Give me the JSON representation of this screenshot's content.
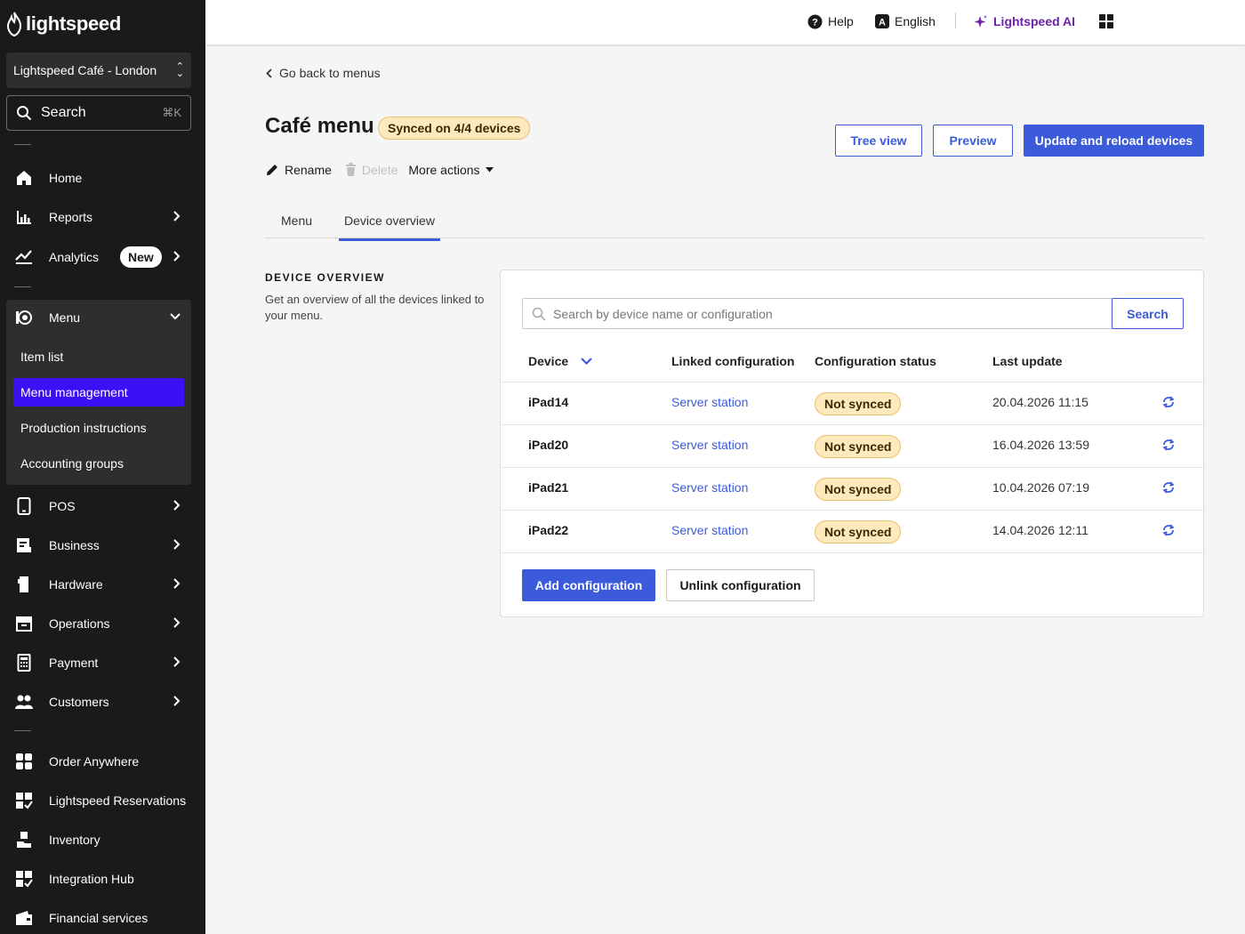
{
  "brand": {
    "logo_text": "lightspeed"
  },
  "sidebar": {
    "location": "Lightspeed Café - London",
    "search": {
      "label": "Search",
      "shortcut": "⌘K"
    },
    "nav": [
      {
        "label": "Home",
        "icon": "home-icon"
      },
      {
        "label": "Reports",
        "icon": "bar-chart-icon"
      },
      {
        "label": "Analytics",
        "icon": "trend-icon",
        "badge": "New"
      },
      {
        "label": "Menu",
        "icon": "menu-icon"
      },
      {
        "label": "POS",
        "icon": "tablet-icon"
      },
      {
        "label": "Business",
        "icon": "business-icon"
      },
      {
        "label": "Hardware",
        "icon": "hardware-icon"
      },
      {
        "label": "Operations",
        "icon": "box-icon"
      },
      {
        "label": "Payment",
        "icon": "calculator-icon"
      },
      {
        "label": "Customers",
        "icon": "users-icon"
      },
      {
        "label": "Order Anywhere",
        "icon": "grid-icon"
      },
      {
        "label": "Lightspeed Reservations",
        "icon": "reservations-icon"
      },
      {
        "label": "Inventory",
        "icon": "inventory-icon"
      },
      {
        "label": "Integration Hub",
        "icon": "integration-icon"
      },
      {
        "label": "Financial services",
        "icon": "wallet-icon"
      }
    ],
    "menu_sub": [
      "Item list",
      "Menu management",
      "Production instructions",
      "Accounting groups"
    ],
    "active_sub": "Menu management"
  },
  "topbar": {
    "help": "Help",
    "language": "English",
    "ai": "Lightspeed AI"
  },
  "page": {
    "back": "Go back to menus",
    "title": "Café menu",
    "sync_badge": "Synced on 4/4 devices",
    "actions": {
      "rename": "Rename",
      "delete": "Delete",
      "more": "More actions"
    },
    "buttons": {
      "tree_view": "Tree view",
      "preview": "Preview",
      "update": "Update and reload devices"
    },
    "tabs": [
      "Menu",
      "Device overview"
    ],
    "active_tab": "Device overview",
    "section": {
      "title": "DEVICE OVERVIEW",
      "description": "Get an overview of all the devices linked to your menu."
    },
    "device_search": {
      "placeholder": "Search by device name or configuration",
      "button": "Search"
    },
    "table": {
      "headers": [
        "Device",
        "Linked configuration",
        "Configuration status",
        "Last update"
      ],
      "rows": [
        {
          "device": "iPad14",
          "config": "Server station",
          "status": "Not synced",
          "updated": "20.04.2026 11:15"
        },
        {
          "device": "iPad20",
          "config": "Server station",
          "status": "Not synced",
          "updated": "16.04.2026 13:59"
        },
        {
          "device": "iPad21",
          "config": "Server station",
          "status": "Not synced",
          "updated": "10.04.2026 07:19"
        },
        {
          "device": "iPad22",
          "config": "Server station",
          "status": "Not synced",
          "updated": "14.04.2026 12:11"
        }
      ]
    },
    "footer_buttons": {
      "add": "Add configuration",
      "unlink": "Unlink configuration"
    }
  },
  "colors": {
    "accent": "#3b5bdb",
    "active_nav": "#3b10f5",
    "sidebar_bg": "#1a1a1a",
    "badge_bg": "#fde9bb",
    "ai": "#6b21a8"
  }
}
